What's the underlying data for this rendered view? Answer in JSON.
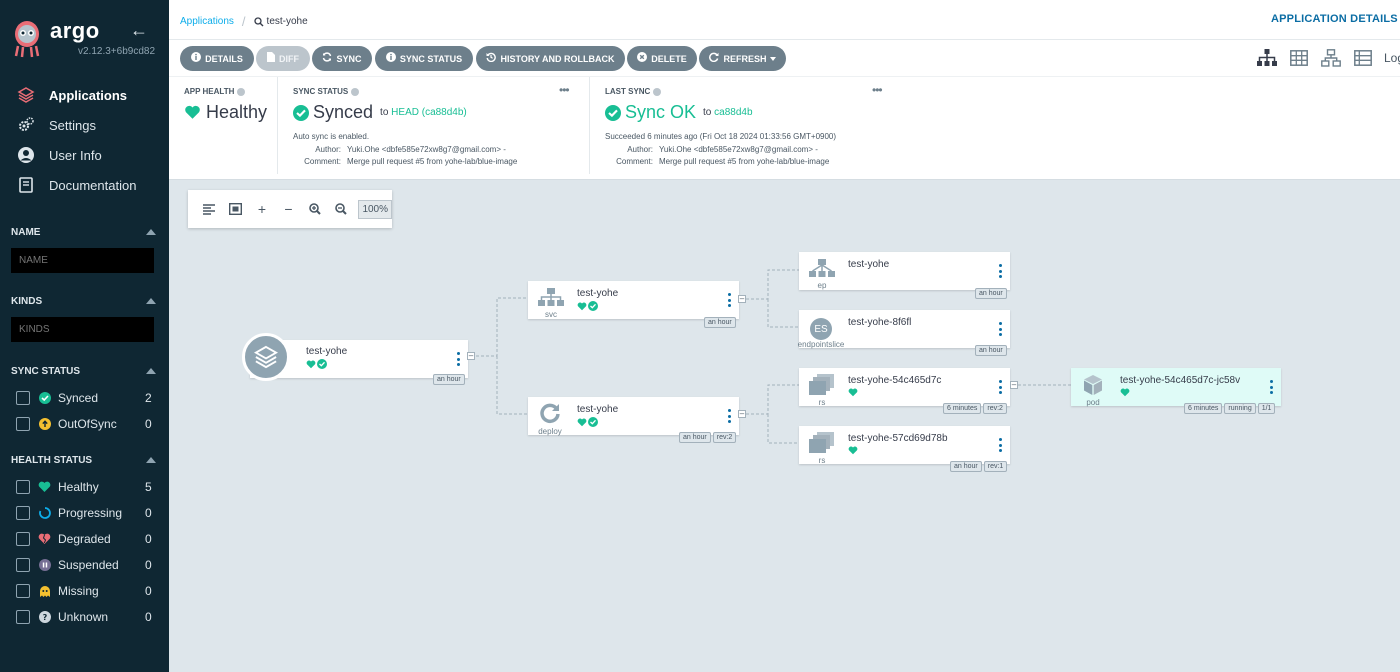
{
  "sidebar": {
    "logo_text": "argo",
    "version": "v2.12.3+6b9cd82",
    "nav": [
      {
        "label": "Applications",
        "icon": "stack-icon",
        "active": true
      },
      {
        "label": "Settings",
        "icon": "gears-icon",
        "active": false
      },
      {
        "label": "User Info",
        "icon": "user-icon",
        "active": false
      },
      {
        "label": "Documentation",
        "icon": "book-icon",
        "active": false
      }
    ],
    "filters": {
      "name": {
        "title": "NAME",
        "placeholder": "NAME"
      },
      "kinds": {
        "title": "KINDS",
        "placeholder": "KINDS"
      },
      "sync_status": {
        "title": "SYNC STATUS",
        "items": [
          {
            "label": "Synced",
            "count": "2",
            "color": "#18be94"
          },
          {
            "label": "OutOfSync",
            "count": "0",
            "color": "#f4c030"
          }
        ]
      },
      "health_status": {
        "title": "HEALTH STATUS",
        "items": [
          {
            "label": "Healthy",
            "count": "5",
            "color": "#18be94"
          },
          {
            "label": "Progressing",
            "count": "0",
            "color": "#0dadea"
          },
          {
            "label": "Degraded",
            "count": "0",
            "color": "#e96d76"
          },
          {
            "label": "Suspended",
            "count": "0",
            "color": "#766f94"
          },
          {
            "label": "Missing",
            "count": "0",
            "color": "#f4c030"
          },
          {
            "label": "Unknown",
            "count": "0",
            "color": "#ccd6dd"
          }
        ]
      }
    }
  },
  "header": {
    "breadcrumb_root": "Applications",
    "breadcrumb_current": "test-yohe",
    "title": "APPLICATION DETAILS T"
  },
  "toolbar": {
    "details": "DETAILS",
    "diff": "DIFF",
    "sync": "SYNC",
    "sync_status": "SYNC STATUS",
    "history": "HISTORY AND ROLLBACK",
    "delete": "DELETE",
    "refresh": "REFRESH",
    "logs": "Log"
  },
  "status": {
    "app_health": {
      "label": "APP HEALTH",
      "value": "Healthy"
    },
    "sync_status": {
      "label": "SYNC STATUS",
      "value": "Synced",
      "to": "to",
      "revision": "HEAD (ca88d4b)",
      "auto": "Auto sync is enabled.",
      "author_key": "Author:",
      "author": "Yuki.Ohe <dbfe585e72xw8g7@gmail.com> -",
      "comment_key": "Comment:",
      "comment": "Merge pull request #5 from yohe-lab/blue-image"
    },
    "last_sync": {
      "label": "LAST SYNC",
      "value": "Sync OK",
      "to": "to",
      "revision": "ca88d4b",
      "succeeded": "Succeeded 6 minutes ago (Fri Oct 18 2024 01:33:56 GMT+0900)",
      "author_key": "Author:",
      "author": "Yuki.Ohe <dbfe585e72xw8g7@gmail.com> -",
      "comment_key": "Comment:",
      "comment": "Merge pull request #5 from yohe-lab/blue-image"
    },
    "menu_dots": "•••"
  },
  "canvas": {
    "zoom": "100%",
    "nodes": {
      "app": {
        "name": "test-yohe",
        "kind": "",
        "tags": [
          "an hour"
        ]
      },
      "svc": {
        "name": "test-yohe",
        "kind": "svc",
        "tags": [
          "an hour"
        ]
      },
      "deploy": {
        "name": "test-yohe",
        "kind": "deploy",
        "tags": [
          "an hour",
          "rev:2"
        ]
      },
      "ep": {
        "name": "test-yohe",
        "kind": "ep",
        "tags": [
          "an hour"
        ]
      },
      "endpointslice": {
        "name": "test-yohe-8f6fl",
        "kind": "endpointslice",
        "badge": "ES",
        "tags": [
          "an hour"
        ]
      },
      "rs1": {
        "name": "test-yohe-54c465d7c",
        "kind": "rs",
        "tags": [
          "6 minutes",
          "rev:2"
        ]
      },
      "rs2": {
        "name": "test-yohe-57cd69d78b",
        "kind": "rs",
        "tags": [
          "an hour",
          "rev:1"
        ]
      },
      "pod": {
        "name": "test-yohe-54c465d7c-jc58v",
        "kind": "pod",
        "tags": [
          "6 minutes",
          "running",
          "1/1"
        ]
      }
    }
  },
  "colors": {
    "green": "#18be94",
    "sidebar": "#0f2733",
    "button": "#6d7f8b",
    "pod_bg": "#dffbf7"
  }
}
